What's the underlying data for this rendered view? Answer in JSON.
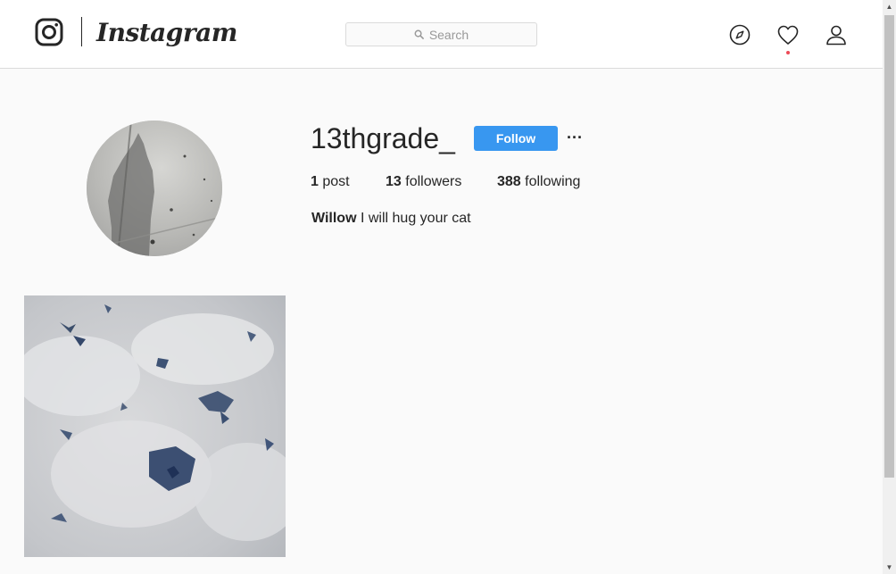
{
  "nav": {
    "brand": "Instagram",
    "search": {
      "placeholder": "Search"
    },
    "icons": [
      "instagram-glyph-icon",
      "compass-icon",
      "heart-icon",
      "user-icon"
    ]
  },
  "profile": {
    "username": "13thgrade_",
    "follow_label": "Follow",
    "more_label": "···",
    "stats": {
      "posts_count": "1",
      "posts_label": "post",
      "followers_count": "13",
      "followers_label": "followers",
      "following_count": "388",
      "following_label": "following"
    },
    "bio": {
      "name": "Willow",
      "text": "I will hug your cat"
    }
  },
  "posts": [
    {
      "subject": "clouds-photo"
    }
  ],
  "colors": {
    "primary": "#3897f0",
    "text": "#262626",
    "border": "#dbdbdb",
    "background": "#fafafa",
    "notification": "#ed4956"
  }
}
